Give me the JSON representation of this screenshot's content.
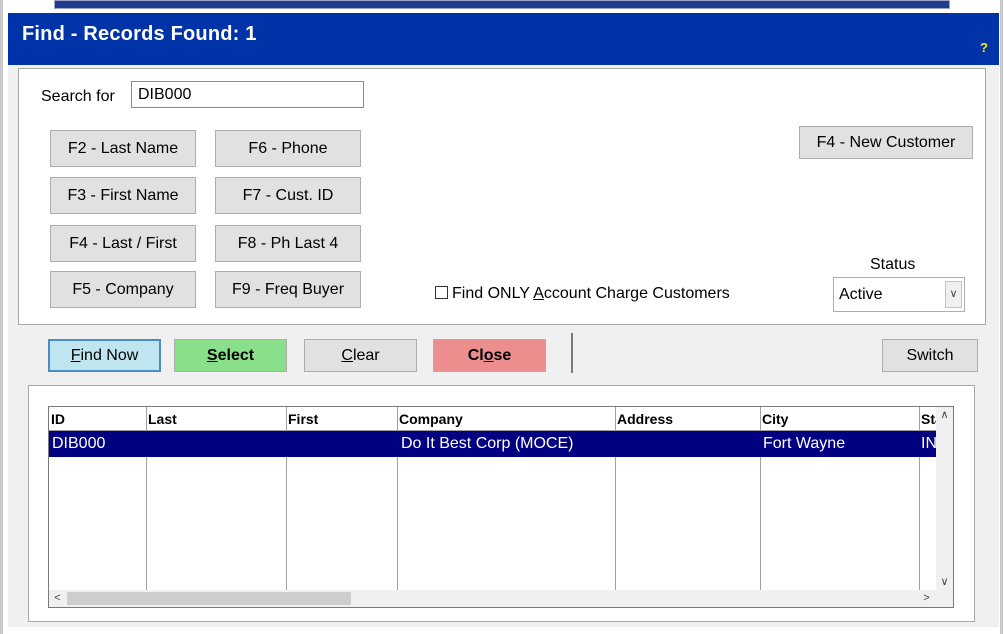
{
  "window": {
    "title": "Find - Records Found: 1",
    "help": "?"
  },
  "search": {
    "label": "Search for",
    "value": "DIB000"
  },
  "fkeys": {
    "last_name": "F2 - Last Name",
    "first_name": "F3 - First Name",
    "last_first": "F4 - Last / First",
    "company": "F5 - Company",
    "phone": "F6 - Phone",
    "cust_id": "F7 - Cust. ID",
    "ph_last4": "F8 - Ph Last 4",
    "freq_buyer": "F9 - Freq Buyer",
    "new_customer": "F4 - New Customer"
  },
  "filter": {
    "account_charge": {
      "before": "Find ONLY ",
      "accel": "A",
      "after": "ccount Charge Customers",
      "checked": false
    }
  },
  "status": {
    "label": "Status",
    "value": "Active"
  },
  "actions": {
    "find_now": {
      "accel": "F",
      "rest": "ind Now"
    },
    "select": {
      "accel": "S",
      "rest": "elect"
    },
    "clear": {
      "accel": "C",
      "rest": "lear"
    },
    "close": {
      "before": "Cl",
      "accel": "o",
      "after": "se"
    },
    "switch": "Switch"
  },
  "grid": {
    "columns": [
      "ID",
      "Last",
      "First",
      "Company",
      "Address",
      "City",
      "Sta"
    ],
    "rows": [
      {
        "id": "DIB000",
        "last": "",
        "first": "",
        "company": "Do It Best Corp (MOCE)",
        "address": "",
        "city": "Fort Wayne",
        "state": "IN"
      }
    ]
  },
  "colors": {
    "title_bar": "#0033a8",
    "selected_row": "#000080",
    "select_button": "#8ae08a",
    "close_button": "#ec8e8e",
    "find_button": "#bfe6f0"
  },
  "icons": {
    "scroll_up": "chevron-up-icon",
    "scroll_down": "chevron-down-icon",
    "scroll_left": "chevron-left-icon",
    "scroll_right": "chevron-right-icon",
    "dropdown": "chevron-down-icon"
  }
}
